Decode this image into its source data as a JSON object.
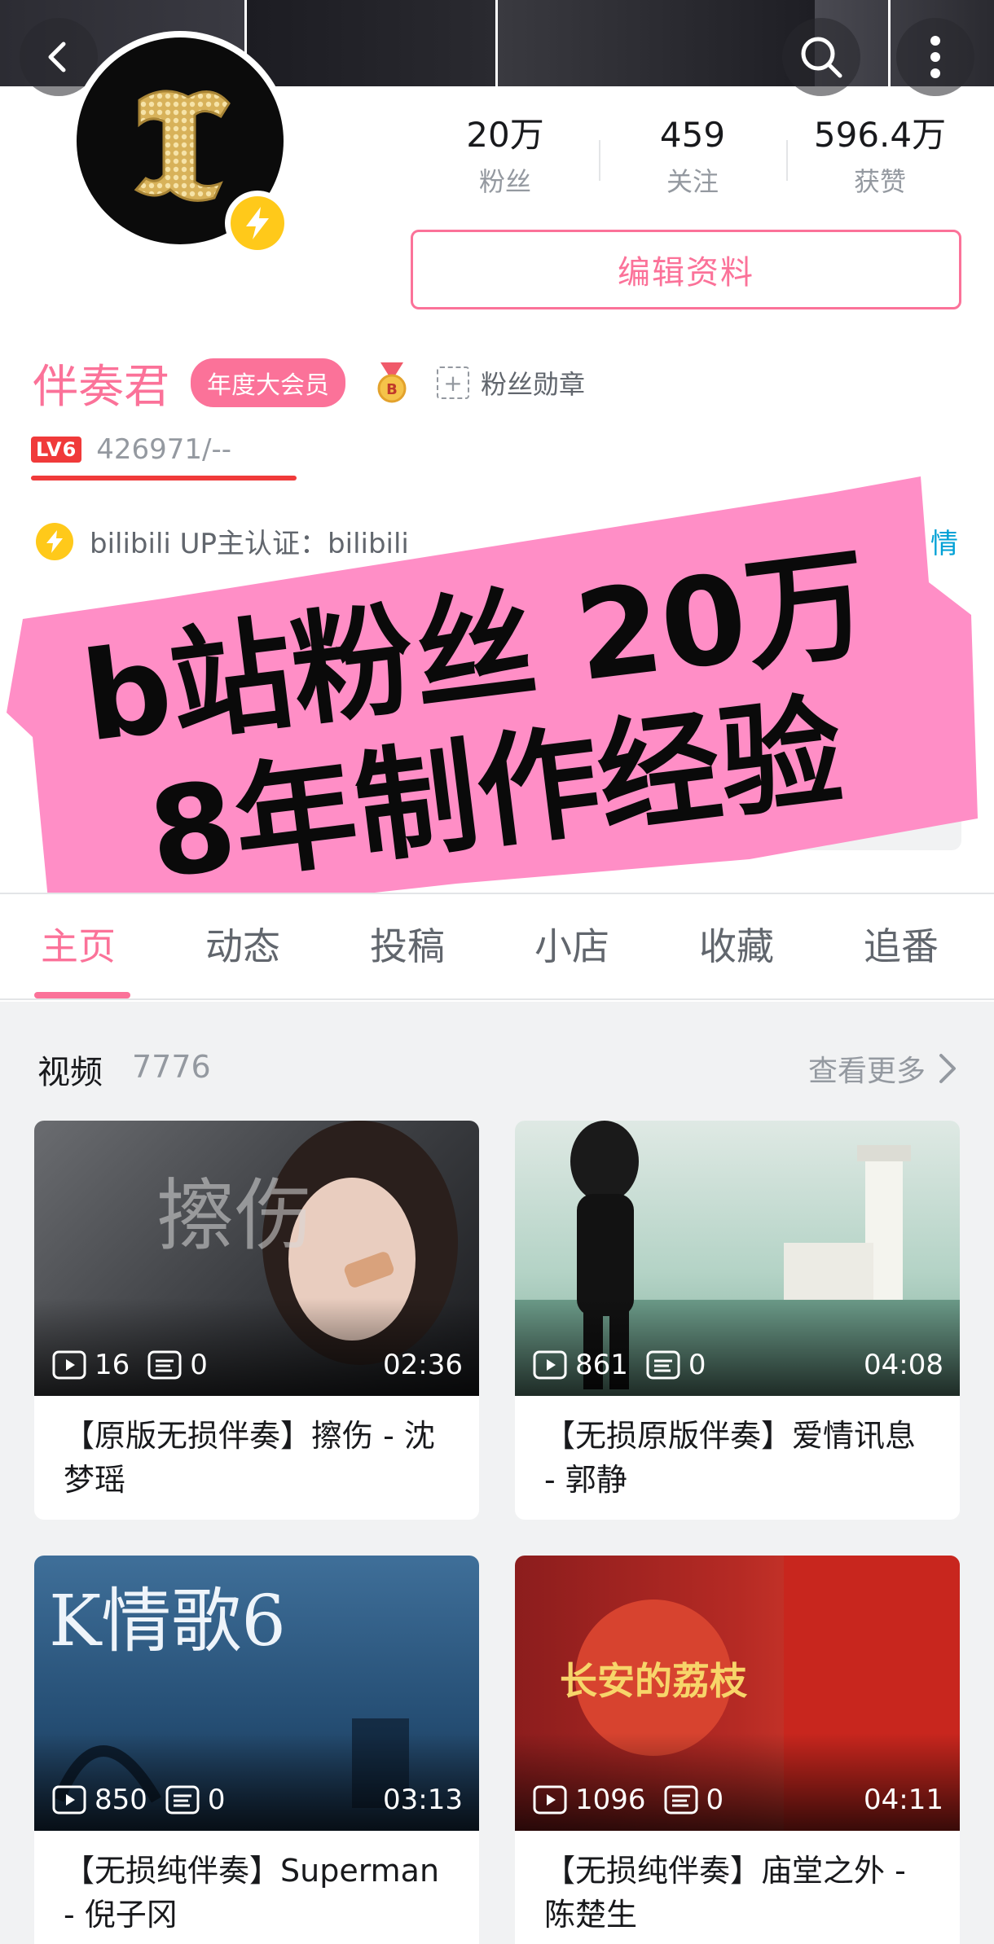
{
  "header": {
    "back_icon": "chevron-left-icon",
    "search_icon": "search-icon",
    "more_icon": "more-vertical-icon"
  },
  "profile": {
    "stats": [
      {
        "value": "20万",
        "label": "粉丝"
      },
      {
        "value": "459",
        "label": "关注"
      },
      {
        "value": "596.4万",
        "label": "获赞"
      }
    ],
    "edit_button": "编辑资料",
    "username": "伴奏君",
    "vip_badge": "年度大会员",
    "fan_medal": "粉丝勋章",
    "level": "LV6",
    "exp": "426971/--",
    "verification": "bilibili UP主认证：bilibili",
    "verification_more": "情"
  },
  "overlay": {
    "line1": "b站粉丝 20万",
    "line2": "8年制作经验",
    "background": "#ff8ec6"
  },
  "tabs": [
    {
      "label": "主页",
      "active": true
    },
    {
      "label": "动态",
      "active": false
    },
    {
      "label": "投稿",
      "active": false
    },
    {
      "label": "小店",
      "active": false
    },
    {
      "label": "收藏",
      "active": false
    },
    {
      "label": "追番",
      "active": false
    }
  ],
  "videos_section": {
    "title": "视频",
    "count": "7776",
    "more": "查看更多",
    "items": [
      {
        "plays": "16",
        "danmaku": "0",
        "duration": "02:36",
        "title": "【原版无损伴奏】擦伤 - 沈梦瑶",
        "thumb_text": "擦伤"
      },
      {
        "plays": "861",
        "danmaku": "0",
        "duration": "04:08",
        "title": "【无损原版伴奏】爱情讯息 - 郭静",
        "thumb_text": ""
      },
      {
        "plays": "850",
        "danmaku": "0",
        "duration": "03:13",
        "title": "【无损纯伴奏】Superman - 倪子冈",
        "thumb_text": "K情歌6"
      },
      {
        "plays": "1096",
        "danmaku": "0",
        "duration": "04:11",
        "title": "【无损纯伴奏】庙堂之外 - 陈楚生",
        "thumb_text": "长安的荔枝"
      }
    ]
  },
  "colors": {
    "accent": "#fb7299",
    "level_red": "#f03a3a",
    "verify_yellow": "#ffc91a",
    "link_blue": "#00a1d6"
  }
}
